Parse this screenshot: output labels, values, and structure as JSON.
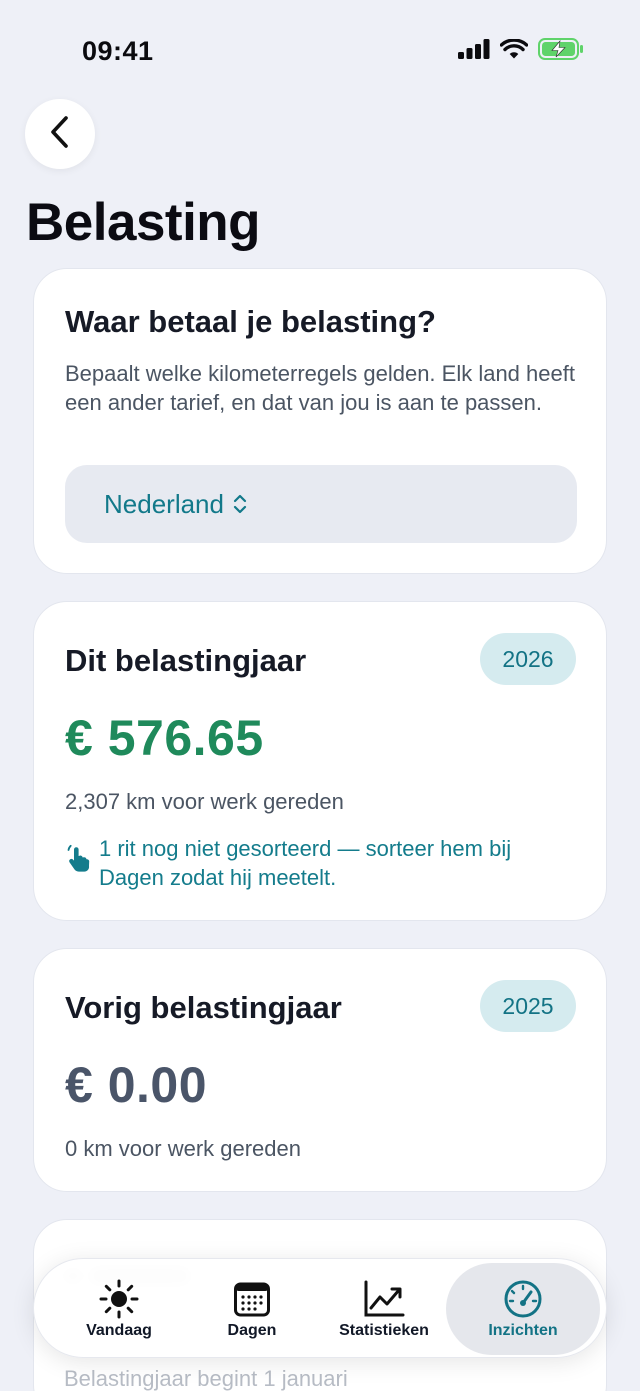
{
  "status": {
    "time": "09:41"
  },
  "page": {
    "title": "Belasting"
  },
  "country_card": {
    "heading": "Waar betaal je belasting?",
    "description": "Bepaalt welke kilometerregels gelden. Elk land heeft een ander tarief, en dat van jou is aan te passen.",
    "selected_country": "Nederland"
  },
  "current_year": {
    "heading": "Dit belastingjaar",
    "year": "2026",
    "amount": "€ 576.65",
    "km": "2,307 km voor werk gereden",
    "notice": "1 rit nog niet gesorteerd — sorteer hem bij Dagen zodat hij meetelt."
  },
  "previous_year": {
    "heading": "Vorig belastingjaar",
    "year": "2025",
    "amount": "€ 0.00",
    "km": "0 km voor werk gereden"
  },
  "next_card": {
    "footer_text": "Belastingjaar begint 1 januari"
  },
  "tabs": [
    {
      "label": "Vandaag",
      "icon": "sun-icon",
      "active": false
    },
    {
      "label": "Dagen",
      "icon": "calendar-icon",
      "active": false
    },
    {
      "label": "Statistieken",
      "icon": "chart-line-icon",
      "active": false
    },
    {
      "label": "Inzichten",
      "icon": "gauge-icon",
      "active": true
    }
  ],
  "colors": {
    "accent": "#137385",
    "amount_positive": "#1f8a5b",
    "amount_zero": "#4a5569",
    "background": "#eef0f7"
  }
}
